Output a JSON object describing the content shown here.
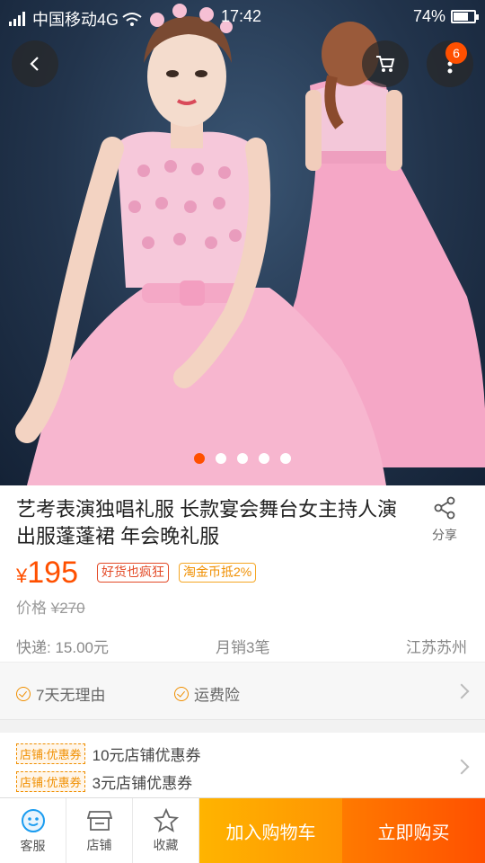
{
  "status_bar": {
    "carrier": "中国移动4G",
    "time": "17:42",
    "battery": "74%",
    "battery_level": 0.74
  },
  "header": {
    "cart_badge": "6"
  },
  "gallery": {
    "image_count": 5,
    "active_index": 0
  },
  "product": {
    "title": "艺考表演独唱礼服 长款宴会舞台女主持人演出服蓬蓬裙 年会晚礼服",
    "share_label": "分享",
    "currency": "¥",
    "price": "195",
    "tags": [
      "好货也疯狂",
      "淘金币抵2%"
    ],
    "orig_price_label": "价格",
    "orig_price": "¥270",
    "shipping": "快递: 15.00元",
    "monthly_sales": "月销3笔",
    "location": "江苏苏州"
  },
  "services": [
    "7天无理由",
    "运费险"
  ],
  "coupons": [
    {
      "tag": "店铺:优惠券",
      "text": "10元店铺优惠券"
    },
    {
      "tag": "店铺:优惠券",
      "text": "3元店铺优惠券"
    }
  ],
  "bottom_bar": {
    "service_label": "客服",
    "shop_label": "店铺",
    "favorite_label": "收藏",
    "add_to_cart": "加入购物车",
    "buy_now": "立即购买"
  },
  "colors": {
    "accent": "#ff5000",
    "cart_button": "#ffa000",
    "dress_pink": "#f7b6cf"
  }
}
